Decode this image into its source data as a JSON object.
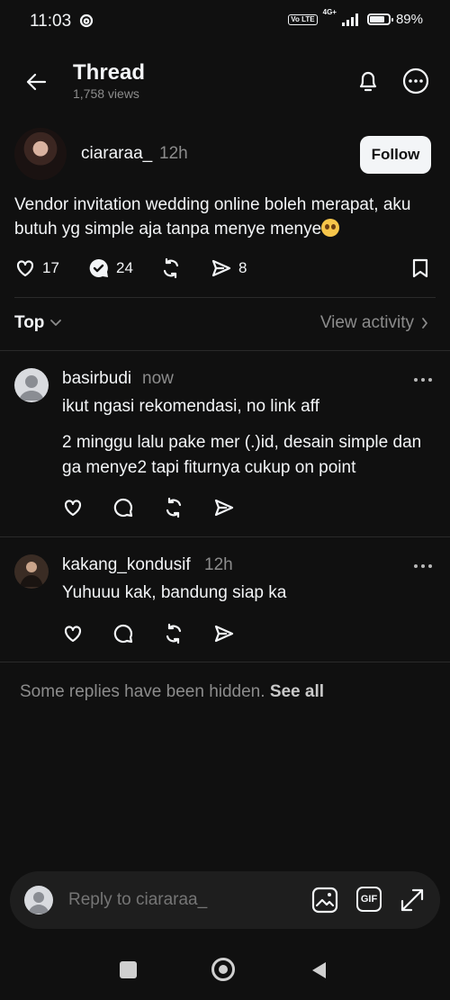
{
  "status_bar": {
    "time": "11:03",
    "volte": "Vo LTE",
    "network": "4G+",
    "battery": "89%"
  },
  "header": {
    "title": "Thread",
    "views": "1,758 views"
  },
  "post": {
    "author": "ciararaa_",
    "time": "12h",
    "follow_label": "Follow",
    "text": "Vendor invitation wedding online boleh merapat, aku butuh yg simple aja tanpa menye menye",
    "likes": "17",
    "replies": "24",
    "shares": "8"
  },
  "sort": {
    "label": "Top",
    "view_activity": "View activity"
  },
  "replies": [
    {
      "username": "basirbudi",
      "time": "now",
      "lines": [
        "ikut ngasi rekomendasi, no link aff",
        "2 minggu lalu pake mer (.)id, desain simple dan ga menye2 tapi fiturnya cukup on point"
      ]
    },
    {
      "username": "kakang_kondusif",
      "time": "12h",
      "lines": [
        "Yuhuuu kak, bandung siap ka"
      ]
    }
  ],
  "hidden_note": {
    "text": "Some replies have been hidden.",
    "link": "See all"
  },
  "composer": {
    "placeholder": "Reply to ciararaa_",
    "gif_label": "GIF"
  },
  "colors": {
    "background": "#101010",
    "text": "#f3f5f7",
    "muted": "#8c8c8c",
    "follow_bg": "#f3f5f7"
  }
}
